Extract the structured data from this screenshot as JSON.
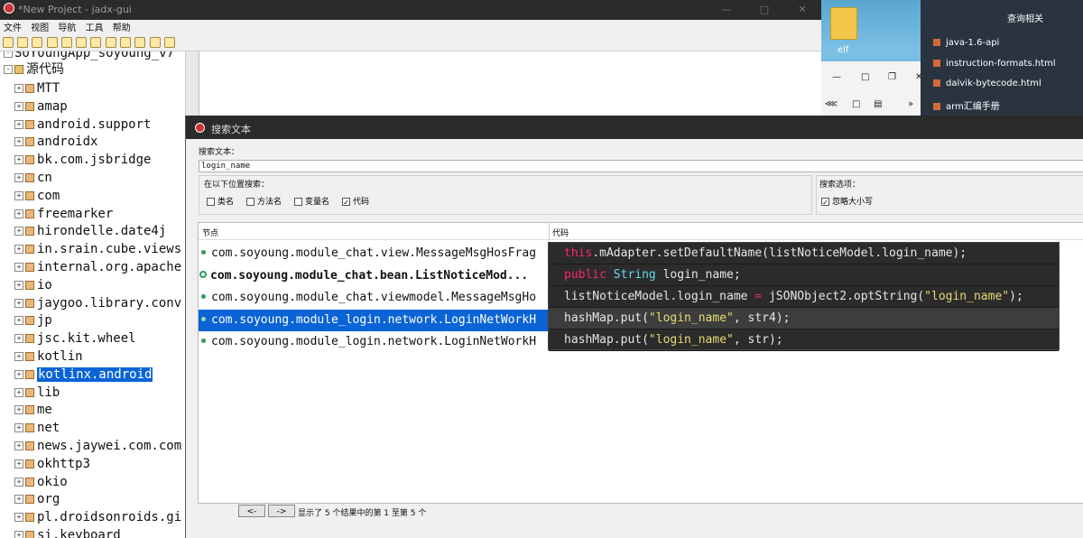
{
  "window": {
    "title": "*New Project - jadx-gui"
  },
  "menu": [
    "文件",
    "视图",
    "导航",
    "工具",
    "帮助"
  ],
  "tree": {
    "root_label": "SoYoungApp_soyoung_v7",
    "source_label": "源代码",
    "packages": [
      "MTT",
      "amap",
      "android.support",
      "androidx",
      "bk.com.jsbridge",
      "cn",
      "com",
      "freemarker",
      "hirondelle.date4j",
      "in.srain.cube.views",
      "internal.org.apache",
      "io",
      "jaygoo.library.conv",
      "jp",
      "jsc.kit.wheel",
      "kotlin",
      "kotlinx.android",
      "lib",
      "me",
      "net",
      "news.jaywei.com.com",
      "okhttp3",
      "okio",
      "org",
      "pl.droidsonroids.gi",
      "si.keyboard"
    ],
    "selected_index": 16
  },
  "desktop": {
    "folder_label": "elf",
    "panel_title": "查询相关",
    "panel_items": [
      "java-1.6-api",
      "instruction-formats.html",
      "dalvik-bytecode.html",
      "arm汇编手册"
    ]
  },
  "dialog": {
    "title": "搜索文本",
    "search_label": "搜索文本：",
    "search_value": "login_name",
    "scope_label": "在以下位置搜索：",
    "scope_options": [
      {
        "label": "类名",
        "checked": false
      },
      {
        "label": "方法名",
        "checked": false
      },
      {
        "label": "变量名",
        "checked": false
      },
      {
        "label": "代码",
        "checked": true
      }
    ],
    "search_options_label": "搜索选项：",
    "ignore_case_label": "忽略大小写",
    "ignore_case_checked": true,
    "columns": {
      "node": "节点",
      "code": "代码"
    },
    "results": [
      {
        "node": "com.soyoung.module_chat.view.MessageMsgHosFrag",
        "kind": "method",
        "selected": false,
        "bold": false
      },
      {
        "node": "com.soyoung.module_chat.bean.ListNoticeMod...",
        "kind": "class",
        "selected": false,
        "bold": true
      },
      {
        "node": "com.soyoung.module_chat.viewmodel.MessageMsgHo",
        "kind": "method",
        "selected": false,
        "bold": false
      },
      {
        "node": "com.soyoung.module_login.network.LoginNetWorkH",
        "kind": "method",
        "selected": true,
        "bold": false
      },
      {
        "node": "com.soyoung.module_login.network.LoginNetWorkH",
        "kind": "method",
        "selected": false,
        "bold": false
      }
    ],
    "code_lines": [
      {
        "parts": [
          {
            "t": "this",
            "c": "kw"
          },
          {
            "t": ".mAdapter.setDefaultName(listNoticeModel.login_name);",
            "c": ""
          }
        ]
      },
      {
        "parts": [
          {
            "t": "public",
            "c": "kw"
          },
          {
            "t": " ",
            "c": ""
          },
          {
            "t": "String",
            "c": "ty"
          },
          {
            "t": " login_name;",
            "c": ""
          }
        ]
      },
      {
        "parts": [
          {
            "t": "listNoticeModel.login_name ",
            "c": ""
          },
          {
            "t": "=",
            "c": "kw"
          },
          {
            "t": " jSONObject2.optString(",
            "c": ""
          },
          {
            "t": "\"login_name\"",
            "c": "str"
          },
          {
            "t": ");",
            "c": ""
          }
        ]
      },
      {
        "parts": [
          {
            "t": "hashMap.put(",
            "c": ""
          },
          {
            "t": "\"login_name\"",
            "c": "str"
          },
          {
            "t": ", str4);",
            "c": ""
          }
        ]
      },
      {
        "parts": [
          {
            "t": "hashMap.put(",
            "c": ""
          },
          {
            "t": "\"login_name\"",
            "c": "str"
          },
          {
            "t": ", str);",
            "c": ""
          }
        ]
      }
    ],
    "highlighted_code_index": 3,
    "prev_label": "<-",
    "next_label": "->",
    "status": "显示了 5 个结果中的第 1 至第 5 个"
  }
}
